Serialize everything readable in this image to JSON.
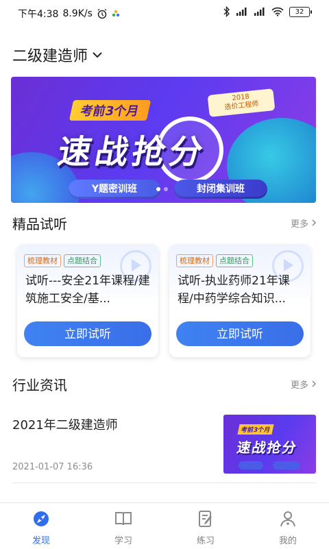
{
  "status_bar": {
    "time": "下午4:38",
    "speed": "8.9K/s",
    "battery": "32"
  },
  "header": {
    "title": "二级建造师"
  },
  "banner": {
    "tagline": "考前3个月",
    "year_badge_line1": "2018",
    "year_badge_line2": "造价工程师",
    "headline": "速战抢分",
    "pill_left": "Y题密训班",
    "pill_right": "封闭集训班"
  },
  "premium_trial": {
    "title": "精品试听",
    "more": "更多",
    "cards": [
      {
        "chips": [
          "梳理教材",
          "点题结合"
        ],
        "title": "试听---安全21年课程/建筑施工安全/基...",
        "button": "立即试听"
      },
      {
        "chips": [
          "梳理教材",
          "点题结合"
        ],
        "title": "试听-执业药师21年课程/中药学综合知识...",
        "button": "立即试听"
      }
    ]
  },
  "industry_news": {
    "title": "行业资讯",
    "more": "更多",
    "items": [
      {
        "title": "2021年二级建造师",
        "time": "2021-01-07 16:36",
        "thumb_tag": "考前3个月",
        "thumb_headline": "速战抢分"
      }
    ]
  },
  "tabbar": {
    "items": [
      {
        "label": "发现",
        "active": true
      },
      {
        "label": "学习",
        "active": false
      },
      {
        "label": "练习",
        "active": false
      },
      {
        "label": "我的",
        "active": false
      }
    ]
  },
  "colors": {
    "accent": "#2f6ef1",
    "button": "#3a7af0",
    "chip_orange": "#d36a1a",
    "chip_green": "#2d9a5a"
  }
}
